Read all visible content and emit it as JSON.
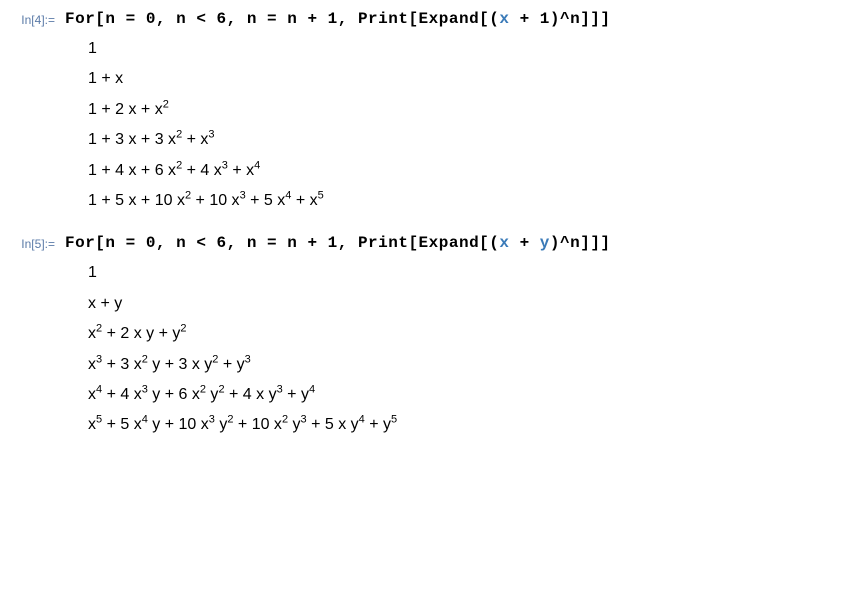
{
  "cells": [
    {
      "labelPrefix": "In[",
      "labelNum": "4",
      "labelSuffix": "]:=",
      "input": {
        "pre": "For[n = 0, n < 6, n = n + 1, Print[Expand[(",
        "sym": "x",
        "mid": " + 1",
        "post": ")^n]]]"
      },
      "output": [
        "1",
        "1 + x",
        "1 + 2 x + x<sup>2</sup>",
        "1 + 3 x + 3 x<sup>2</sup> + x<sup>3</sup>",
        "1 + 4 x + 6 x<sup>2</sup> + 4 x<sup>3</sup> + x<sup>4</sup>",
        "1 + 5 x + 10 x<sup>2</sup> + 10 x<sup>3</sup> + 5 x<sup>4</sup> + x<sup>5</sup>"
      ]
    },
    {
      "labelPrefix": "In[",
      "labelNum": "5",
      "labelSuffix": "]:=",
      "input": {
        "pre": "For[n = 0, n < 6, n = n + 1, Print[Expand[(",
        "sym": "x",
        "mid": " + ",
        "sym2": "y",
        "post": ")^n]]]"
      },
      "output": [
        "1",
        "x + y",
        "x<sup>2</sup> + 2 x y + y<sup>2</sup>",
        "x<sup>3</sup> + 3 x<sup>2</sup> y + 3 x y<sup>2</sup> + y<sup>3</sup>",
        "x<sup>4</sup> + 4 x<sup>3</sup> y + 6 x<sup>2</sup> y<sup>2</sup> + 4 x y<sup>3</sup> + y<sup>4</sup>",
        "x<sup>5</sup> + 5 x<sup>4</sup> y + 10 x<sup>3</sup> y<sup>2</sup> + 10 x<sup>2</sup> y<sup>3</sup> + 5 x y<sup>4</sup> + y<sup>5</sup>"
      ]
    }
  ]
}
